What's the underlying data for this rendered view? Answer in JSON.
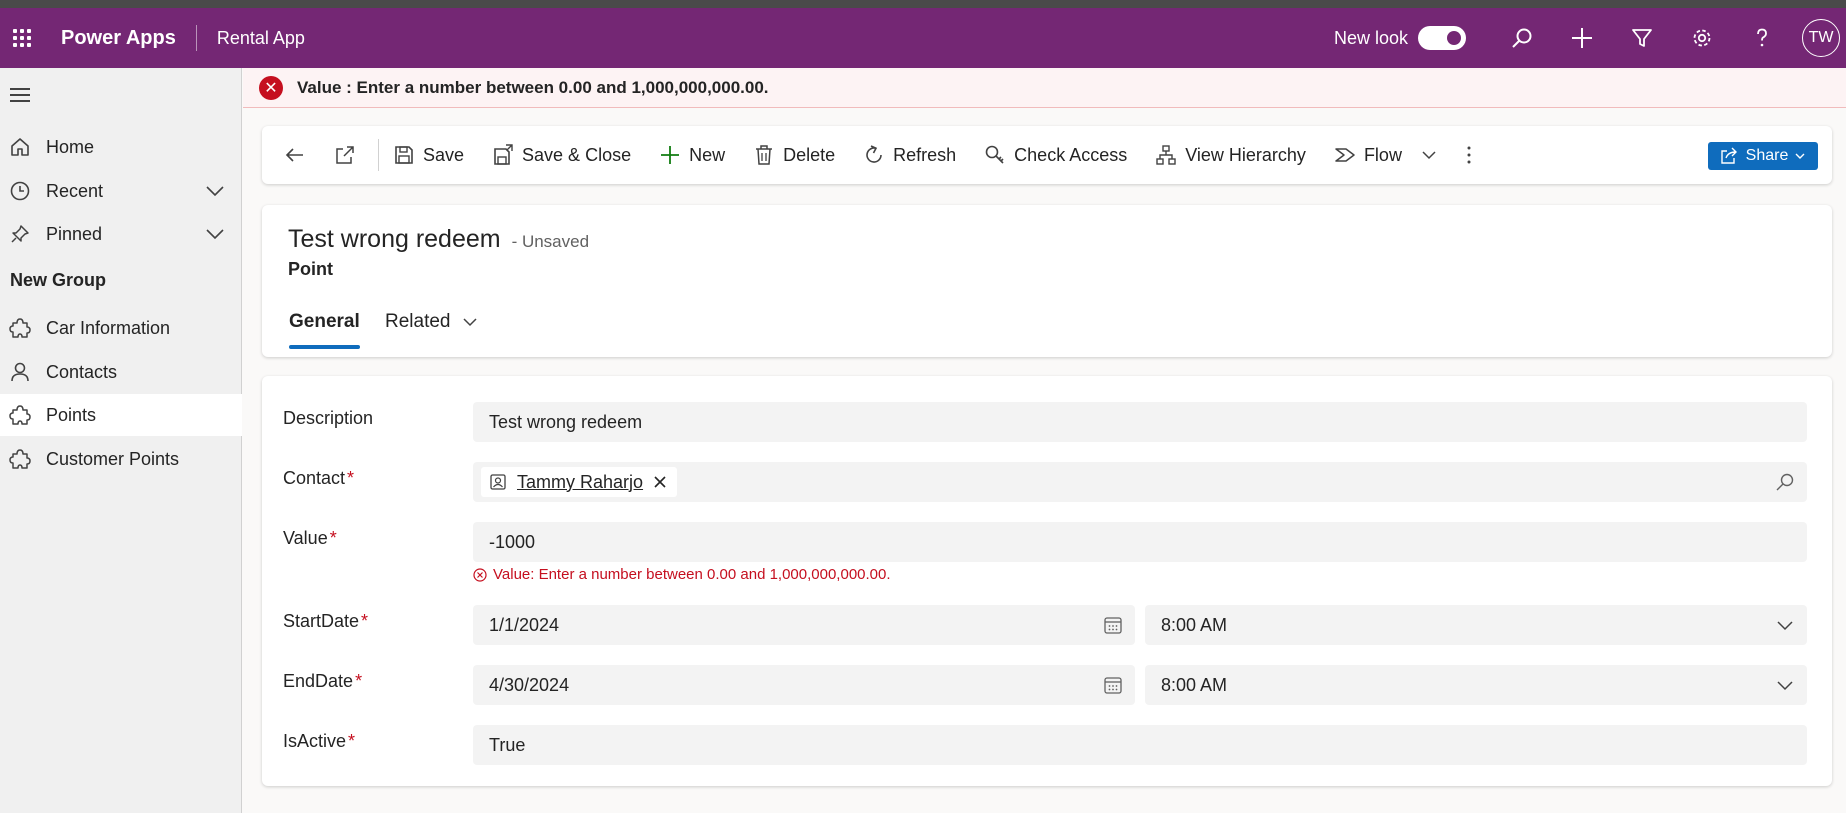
{
  "header": {
    "app_name": "Power Apps",
    "app_sub": "Rental App",
    "new_look_label": "New look",
    "user_initials": "TW"
  },
  "error_banner": {
    "text": "Value : Enter a number between 0.00 and 1,000,000,000.00."
  },
  "sidebar": {
    "items": [
      {
        "label": "Home"
      },
      {
        "label": "Recent"
      },
      {
        "label": "Pinned"
      }
    ],
    "group_title": "New Group",
    "group_items": [
      {
        "label": "Car Information"
      },
      {
        "label": "Contacts"
      },
      {
        "label": "Points"
      },
      {
        "label": "Customer Points"
      }
    ]
  },
  "commands": {
    "save": "Save",
    "save_close": "Save & Close",
    "new": "New",
    "delete": "Delete",
    "refresh": "Refresh",
    "check_access": "Check Access",
    "view_hierarchy": "View Hierarchy",
    "flow": "Flow",
    "share": "Share"
  },
  "record": {
    "title": "Test wrong redeem",
    "status": "- Unsaved",
    "entity": "Point",
    "tabs": [
      "General",
      "Related"
    ]
  },
  "form": {
    "description": {
      "label": "Description",
      "value": "Test wrong redeem"
    },
    "contact": {
      "label": "Contact",
      "value": "Tammy Raharjo"
    },
    "value": {
      "label": "Value",
      "value": "-1000",
      "error": "Value: Enter a number between 0.00 and 1,000,000,000.00."
    },
    "start_date": {
      "label": "StartDate",
      "date": "1/1/2024",
      "time": "8:00 AM"
    },
    "end_date": {
      "label": "EndDate",
      "date": "4/30/2024",
      "time": "8:00 AM"
    },
    "is_active": {
      "label": "IsActive",
      "value": "True"
    },
    "required_mark": "*"
  },
  "colors": {
    "header_bg": "#742774",
    "accent": "#0f6cbd",
    "error": "#c50f1f"
  }
}
